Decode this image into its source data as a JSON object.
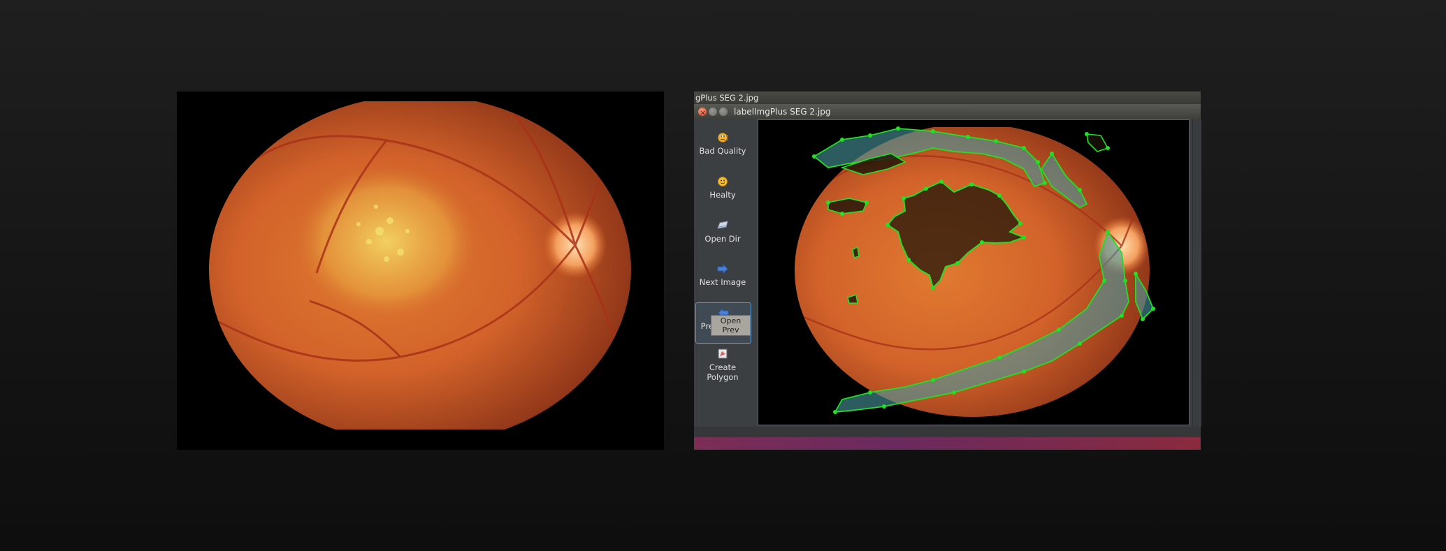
{
  "outer_window": {
    "title": "gPlus SEG 2.jpg"
  },
  "window": {
    "title": "labelImgPlus SEG 2.jpg"
  },
  "toolbar": {
    "items": [
      {
        "label": "Bad Quality",
        "icon": "bad-quality-face-icon"
      },
      {
        "label": "Healty",
        "icon": "smiley-face-icon"
      },
      {
        "label": "Open Dir",
        "icon": "folder-icon"
      },
      {
        "label": "Next Image",
        "icon": "arrow-right-icon"
      },
      {
        "label": "Prev Image",
        "icon": "arrow-left-icon"
      },
      {
        "label": "Create\nPolygon",
        "label_line1": "Create",
        "label_line2": "Polygon",
        "icon": "polygon-icon"
      }
    ],
    "tooltip": "Open Prev"
  },
  "colors": {
    "polygon_outline": "#22e022",
    "polygon_fill_vessel": "#4a9aa0",
    "polygon_fill_lesion": "#1a1a0a",
    "accent_selected": "#5c9bd6"
  }
}
